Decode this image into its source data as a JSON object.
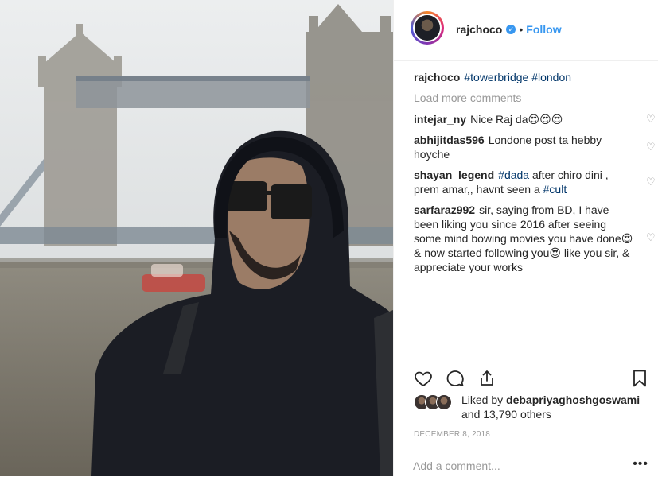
{
  "post": {
    "author": "rajchoco",
    "follow_label": "Follow",
    "dot": "•",
    "caption_user": "rajchoco",
    "caption_tags": [
      "#towerbridge",
      "#london"
    ],
    "load_more": "Load more comments",
    "comments": [
      {
        "user": "intejar_ny",
        "text": "Nice Raj da😍😍😍"
      },
      {
        "user": "abhijitdas596",
        "text": "Londone post ta hebby hoyche"
      },
      {
        "user": "shayan_legend",
        "tag": "#dada",
        "text": " after chiro dini , prem amar,, havnt seen a ",
        "tag2": "#cult"
      },
      {
        "user": "sarfaraz992",
        "text": "sir, saying from BD, I have been liking you since 2016 after seeing some mind bowing movies you have done😍 & now started following you😍 like you sir, & appreciate your works"
      }
    ],
    "liked_by_prefix": "Liked by ",
    "liked_by_user": "debapriyaghoshgoswami",
    "liked_by_suffix": "and 13,790 others",
    "date": "December 8, 2018",
    "add_comment_placeholder": "Add a comment...",
    "more_label": "•••"
  },
  "icons": {
    "heart": "heart-icon",
    "comment": "comment-icon",
    "share": "share-icon",
    "save": "bookmark-icon",
    "verified": "verified-badge-icon"
  },
  "colors": {
    "link": "#3897f0",
    "hashtag": "#003569",
    "muted": "#999999",
    "text": "#262626"
  }
}
